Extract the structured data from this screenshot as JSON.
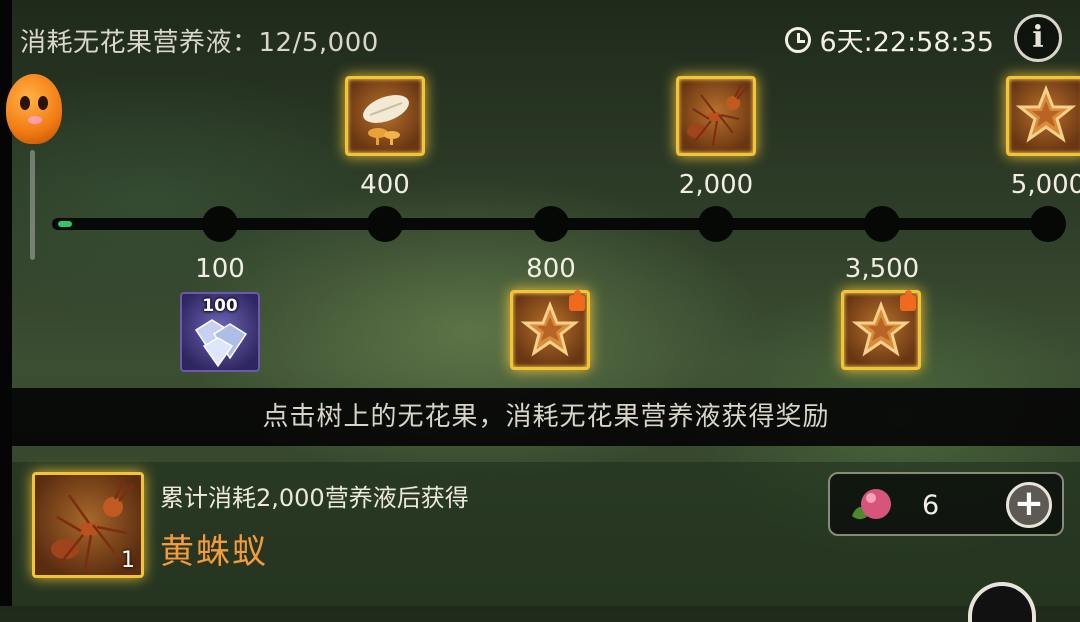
{
  "header": {
    "consumed_label": "消耗无花果营养液：12/5,000",
    "timer": "6天:22:58:35",
    "info_label": "i"
  },
  "progress": {
    "current": 12,
    "max": 5000,
    "fraction": 0.0024,
    "color": "#32c46a"
  },
  "milestones": [
    {
      "value": "100",
      "position": "below",
      "reward_icon": "diamond-icon",
      "reward_count": "100"
    },
    {
      "value": "400",
      "position": "above",
      "reward_icon": "larva-egg-icon"
    },
    {
      "value": "800",
      "position": "below",
      "reward_icon": "star-badge-puzzle-icon"
    },
    {
      "value": "2,000",
      "position": "above",
      "reward_icon": "ant-icon"
    },
    {
      "value": "3,500",
      "position": "below",
      "reward_icon": "star-badge-puzzle-icon"
    },
    {
      "value": "5,000",
      "position": "above",
      "reward_icon": "star-badge-icon"
    }
  ],
  "banner": {
    "text": "点击树上的无花果，消耗无花果营养液获得奖励"
  },
  "bottom": {
    "requirement": "累计消耗2,000营养液后获得",
    "reward_name": "黄蛛蚁",
    "reward_qty": "1",
    "reward_icon": "ant-icon",
    "name_color": "#f39a3a"
  },
  "currency": {
    "icon": "fig-icon",
    "value": "6",
    "add_label": "+"
  }
}
